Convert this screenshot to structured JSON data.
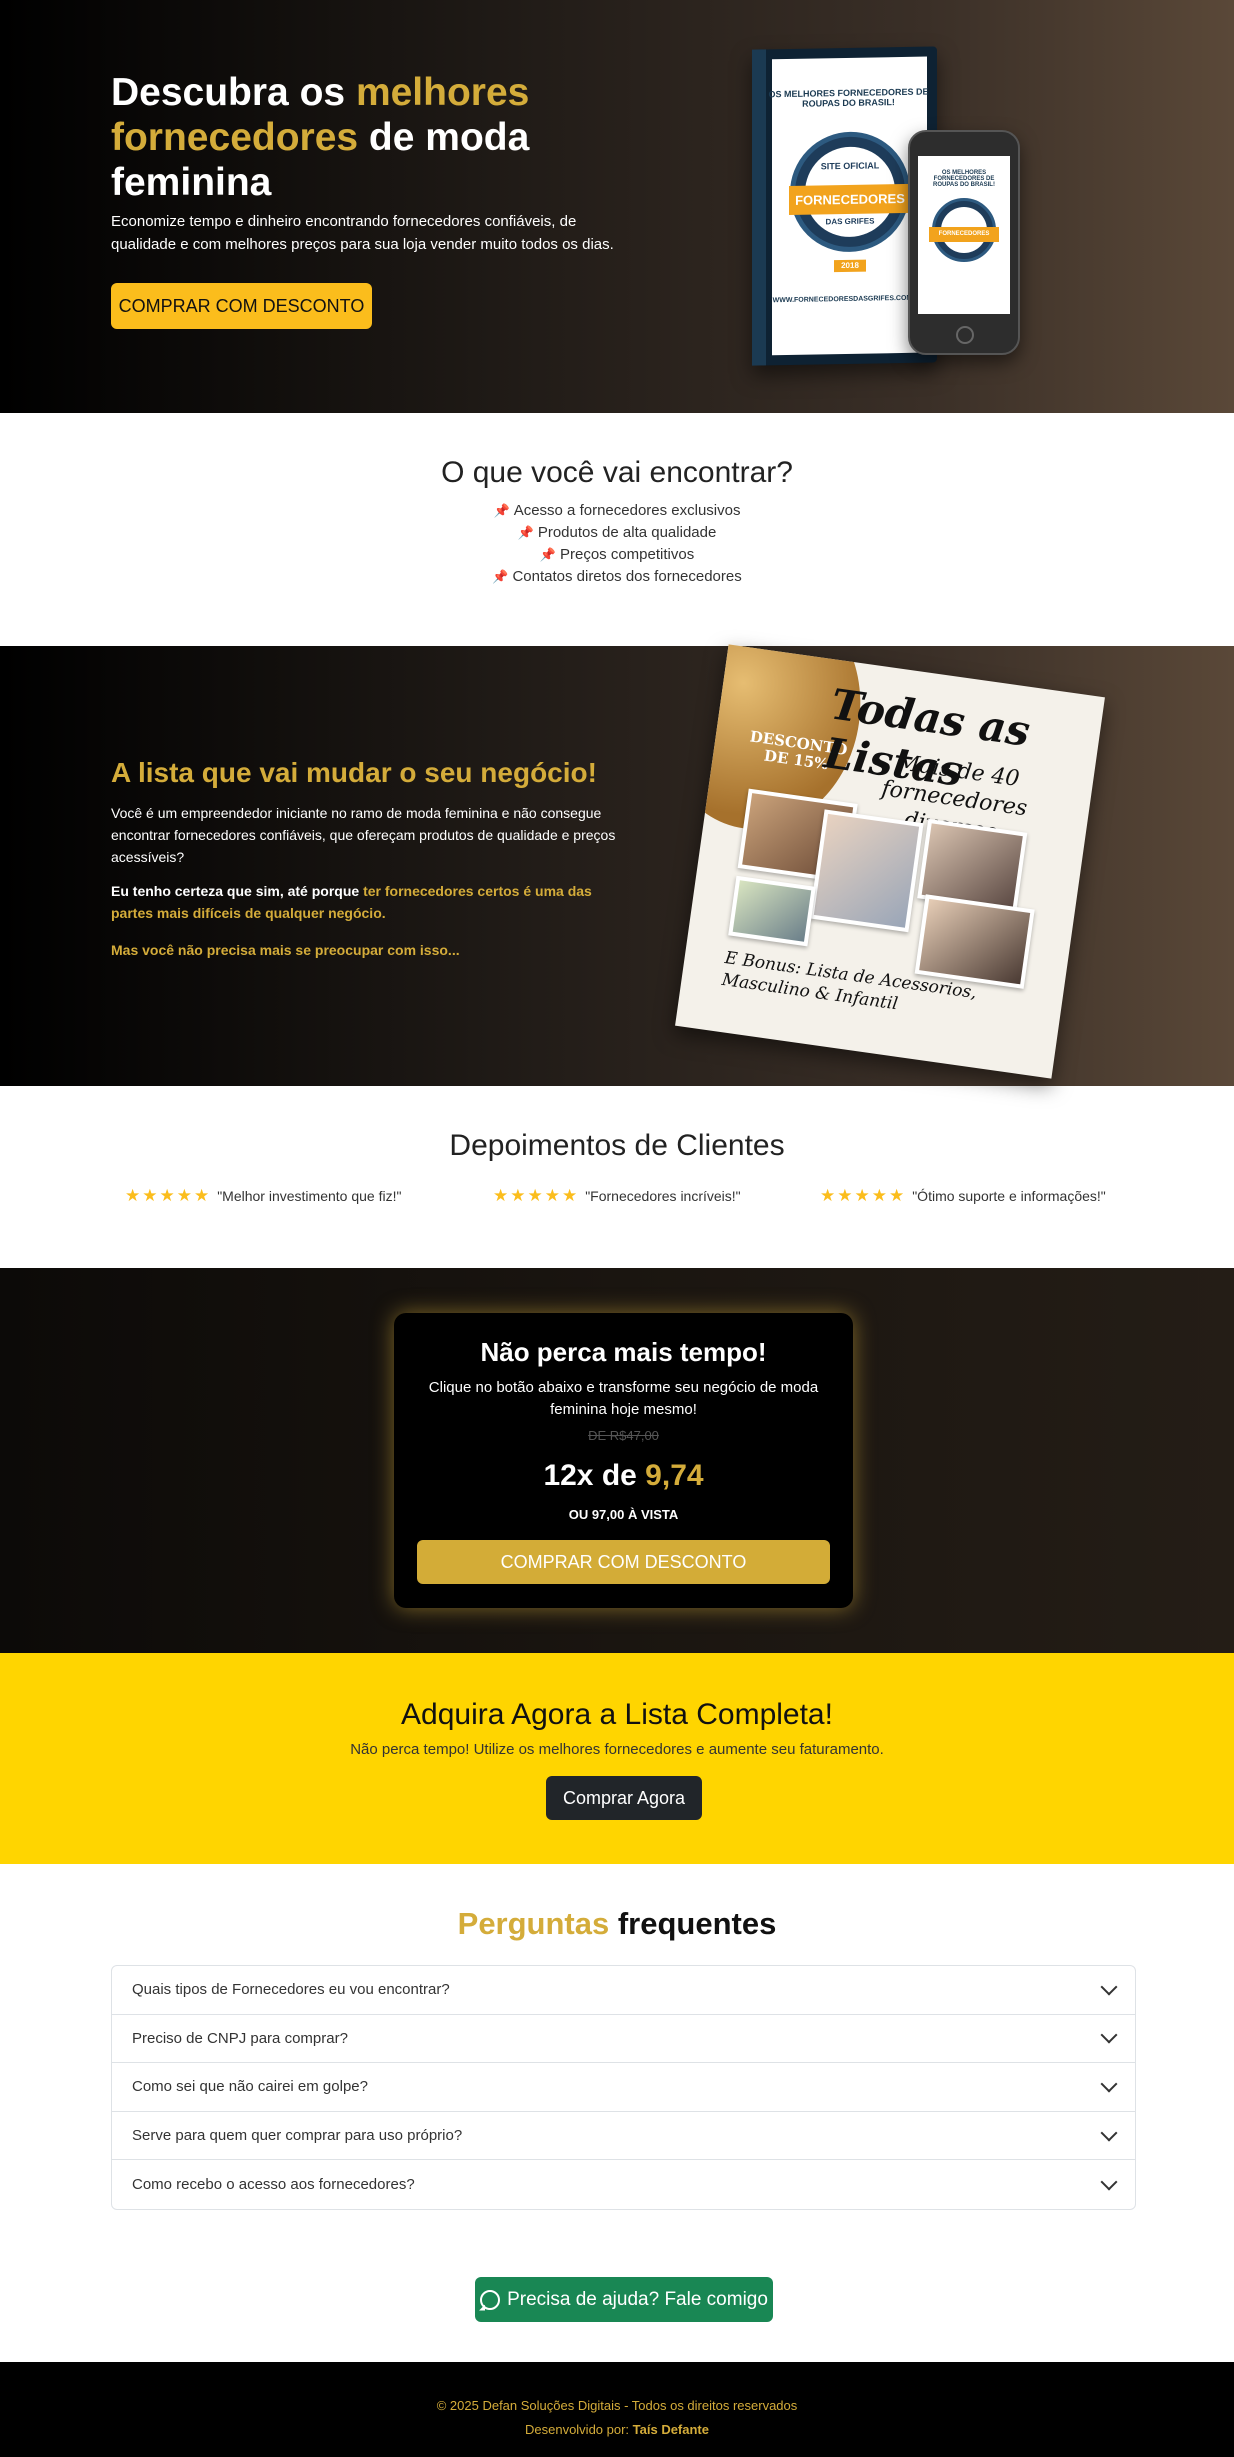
{
  "hero": {
    "title_part1": "Descubra os ",
    "title_highlight": "melhores fornecedores",
    "title_part2": " de moda feminina",
    "description": "Economize tempo e dinheiro encontrando fornecedores confiáveis, de qualidade e com melhores preços para sua loja vender muito todos os dias.",
    "button_label": "COMPRAR COM DESCONTO",
    "book": {
      "top_text": "OS MELHORES FORNECEDORES DE ROUPAS DO BRASIL!",
      "seal_text": "SITE OFICIAL",
      "band_text": "FORNECEDORES",
      "seal_bottom": "DAS GRIFES",
      "url": "WWW.FORNECEDORESDASGRIFES.COM.BR",
      "year": "2018"
    },
    "phone": {
      "top_text": "OS MELHORES FORNECEDORES DE ROUPAS DO BRASIL!",
      "band_text": "FORNECEDORES"
    }
  },
  "features": {
    "title": "O que você vai encontrar?",
    "items": [
      "Acesso a fornecedores exclusivos",
      "Produtos de alta qualidade",
      "Preços competitivos",
      "Contatos diretos dos fornecedores"
    ],
    "pin_glyph": "📌"
  },
  "business": {
    "title": "A lista que vai mudar o seu negócio!",
    "paragraph1": "Você é um empreendedor iniciante no ramo de moda feminina e não consegue encontrar fornecedores confiáveis, que ofereçam produtos de qualidade e preços acessíveis?",
    "paragraph2_strong": "Eu tenho certeza que sim, até porque ",
    "paragraph2_gold": "ter fornecedores certos é uma das partes mais difíceis de qualquer negócio.",
    "paragraph3": "Mas você não precisa mais se preocupar com isso...",
    "poster": {
      "title": "Todas as Listas",
      "subtitle": "Mais de 40 fornecedores diversos",
      "discount": "DESCONTO DE 15%",
      "bonus": "E Bonus: Lista de Acessorios, Masculino & Infantil"
    }
  },
  "testimonials": {
    "title": "Depoimentos de Clientes",
    "stars": "★★★★★",
    "items": [
      "\"Melhor investimento que fiz!\"",
      "\"Fornecedores incríveis!\"",
      "\"Ótimo suporte e informações!\""
    ]
  },
  "offer": {
    "title": "Não perca mais tempo!",
    "description": "Clique no botão abaixo e transforme seu negócio de moda feminina hoje mesmo!",
    "old_price": "DE R$47,00",
    "price_prefix": "12x de ",
    "price_value": "9,74",
    "cash_price": "OU 97,00 À VISTA",
    "button_label": "COMPRAR COM DESCONTO"
  },
  "cta": {
    "title": "Adquira Agora a Lista Completa!",
    "subtitle": "Não perca tempo! Utilize os melhores fornecedores e aumente seu faturamento.",
    "button_label": "Comprar Agora"
  },
  "faq": {
    "title_highlight": "Perguntas",
    "title_rest": " frequentes",
    "items": [
      "Quais tipos de Fornecedores eu vou encontrar?",
      "Preciso de CNPJ para comprar?",
      "Como sei que não cairei em golpe?",
      "Serve para quem quer comprar para uso próprio?",
      "Como recebo o acesso aos fornecedores?"
    ]
  },
  "help_button_label": "Precisa de ajuda? Fale comigo",
  "footer": {
    "copyright": "© 2025 Defan Soluções Digitais - Todos os direitos reservados",
    "dev_prefix": "Desenvolvido por: ",
    "dev_name": "Taís Defante"
  },
  "colors": {
    "gold": "#d4ac3a",
    "yellow_button": "#fbbd1c",
    "cta_yellow": "#ffd500",
    "whatsapp_green": "#198754"
  }
}
